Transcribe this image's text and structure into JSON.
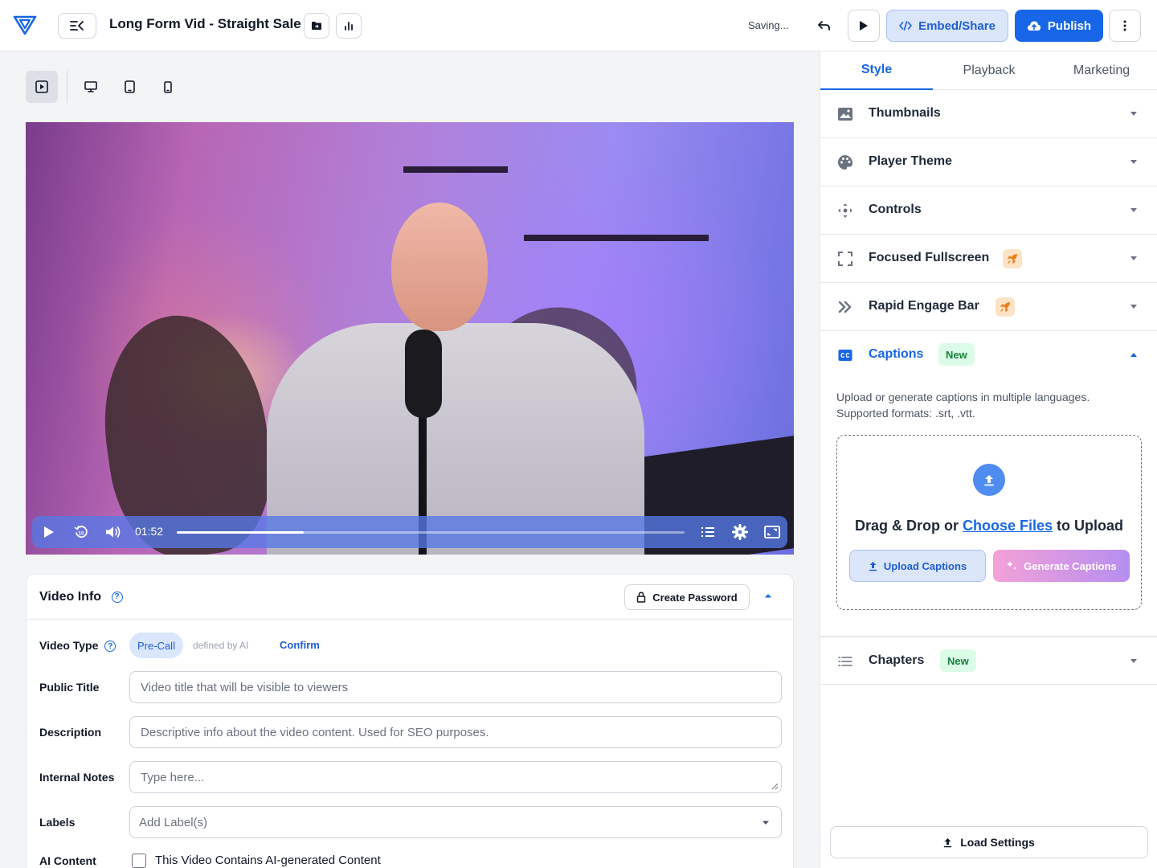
{
  "header": {
    "title": "Long Form Vid - Straight Sale",
    "status": "Saving...",
    "embed_label": "Embed/Share",
    "publish_label": "Publish"
  },
  "player": {
    "time": "01:52",
    "progress": 0.25
  },
  "video_info": {
    "title": "Video Info",
    "help": "?",
    "create_password": "Create Password",
    "video_type_label": "Video Type",
    "video_type_value": "Pre-Call",
    "ai_note": "defined by AI",
    "confirm": "Confirm",
    "public_title_label": "Public Title",
    "public_title_placeholder": "Video title that will be visible to viewers",
    "description_label": "Description",
    "description_placeholder": "Descriptive info about the video content. Used for SEO purposes.",
    "notes_label": "Internal Notes",
    "notes_placeholder": "Type here...",
    "labels_label": "Labels",
    "labels_placeholder": "Add Label(s)",
    "ai_content_label": "AI Content",
    "ai_content_checkbox": "This Video Contains AI-generated Content"
  },
  "panel": {
    "tabs": [
      {
        "label": "Style"
      },
      {
        "label": "Playback"
      },
      {
        "label": "Marketing"
      }
    ],
    "sections": {
      "thumbnails": "Thumbnails",
      "player_theme": "Player Theme",
      "controls": "Controls",
      "focused_fullscreen": "Focused Fullscreen",
      "rapid_engage_bar": "Rapid Engage Bar",
      "captions": "Captions",
      "chapters": "Chapters"
    },
    "new_badge": "New",
    "captions": {
      "description": "Upload or generate captions in multiple languages. Supported formats: .srt, .vtt.",
      "drop_prefix": "Drag & Drop or ",
      "drop_link": "Choose Files",
      "drop_suffix": " to Upload",
      "upload_label": "Upload Captions",
      "generate_label": "Generate Captions"
    },
    "load_settings": "Load Settings"
  },
  "colors": {
    "accent": "#1766e8",
    "new_badge_bg": "#dcfce7",
    "new_badge_text": "#15803d"
  }
}
